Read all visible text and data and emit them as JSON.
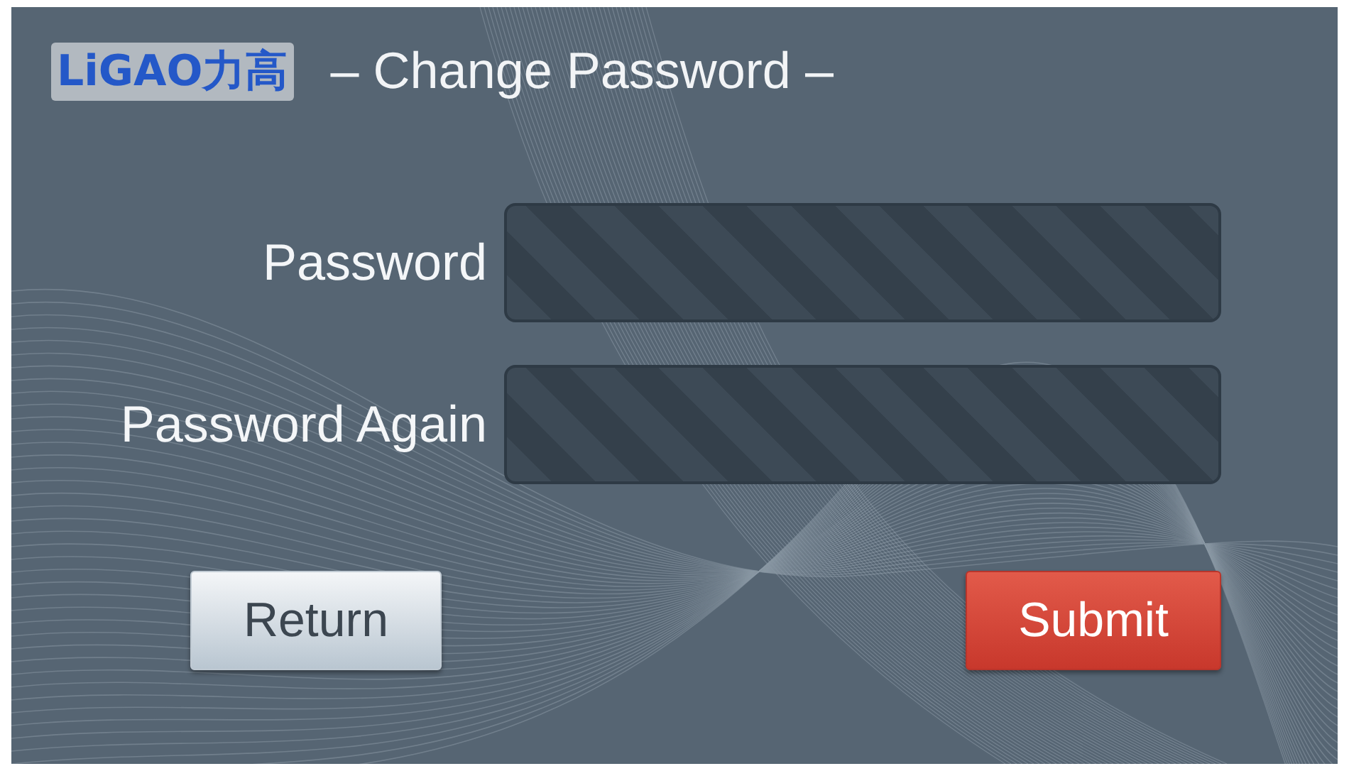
{
  "header": {
    "logo": "LiGAO",
    "logo_cjk": "力高",
    "title": "– Change Password –"
  },
  "fields": [
    {
      "label": "Password"
    },
    {
      "label": "Password Again"
    }
  ],
  "buttons": [
    {
      "label": "Return",
      "kind": "secondary"
    },
    {
      "label": "Submit",
      "kind": "primary"
    }
  ]
}
